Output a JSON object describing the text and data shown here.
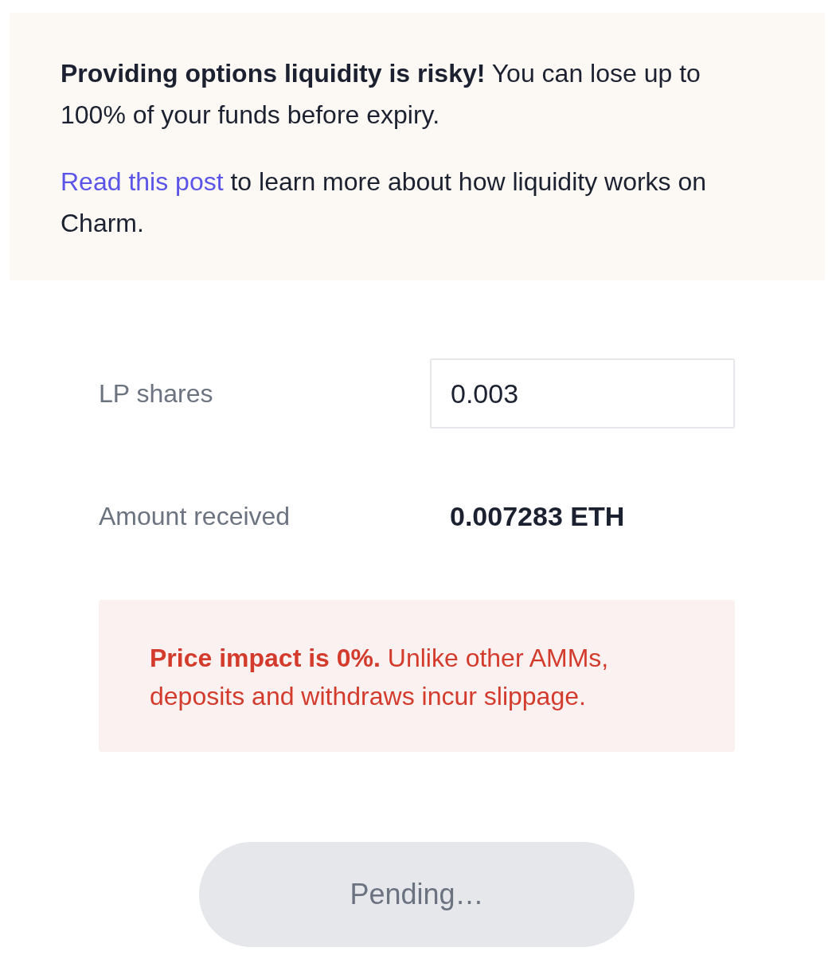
{
  "warning": {
    "paragraphs": [
      {
        "text": "**Providing options liquidity is risky!** You can lose up to 100% of your funds before expiry."
      },
      {
        "link": "Read this post",
        "text": "to learn more about how liquidity works on Charm."
      }
    ]
  },
  "fields": [
    {
      "kind": "input",
      "label": "LP shares",
      "value": "0.003"
    },
    {
      "kind": "output",
      "label": "Amount received",
      "value": "0.007283 ETH"
    }
  ],
  "notice": {
    "text": "**Price impact is 0%.** Unlike other AMMs, deposits and withdraws incur slippage."
  },
  "button": {
    "label": "Pending…",
    "disabled": true
  }
}
